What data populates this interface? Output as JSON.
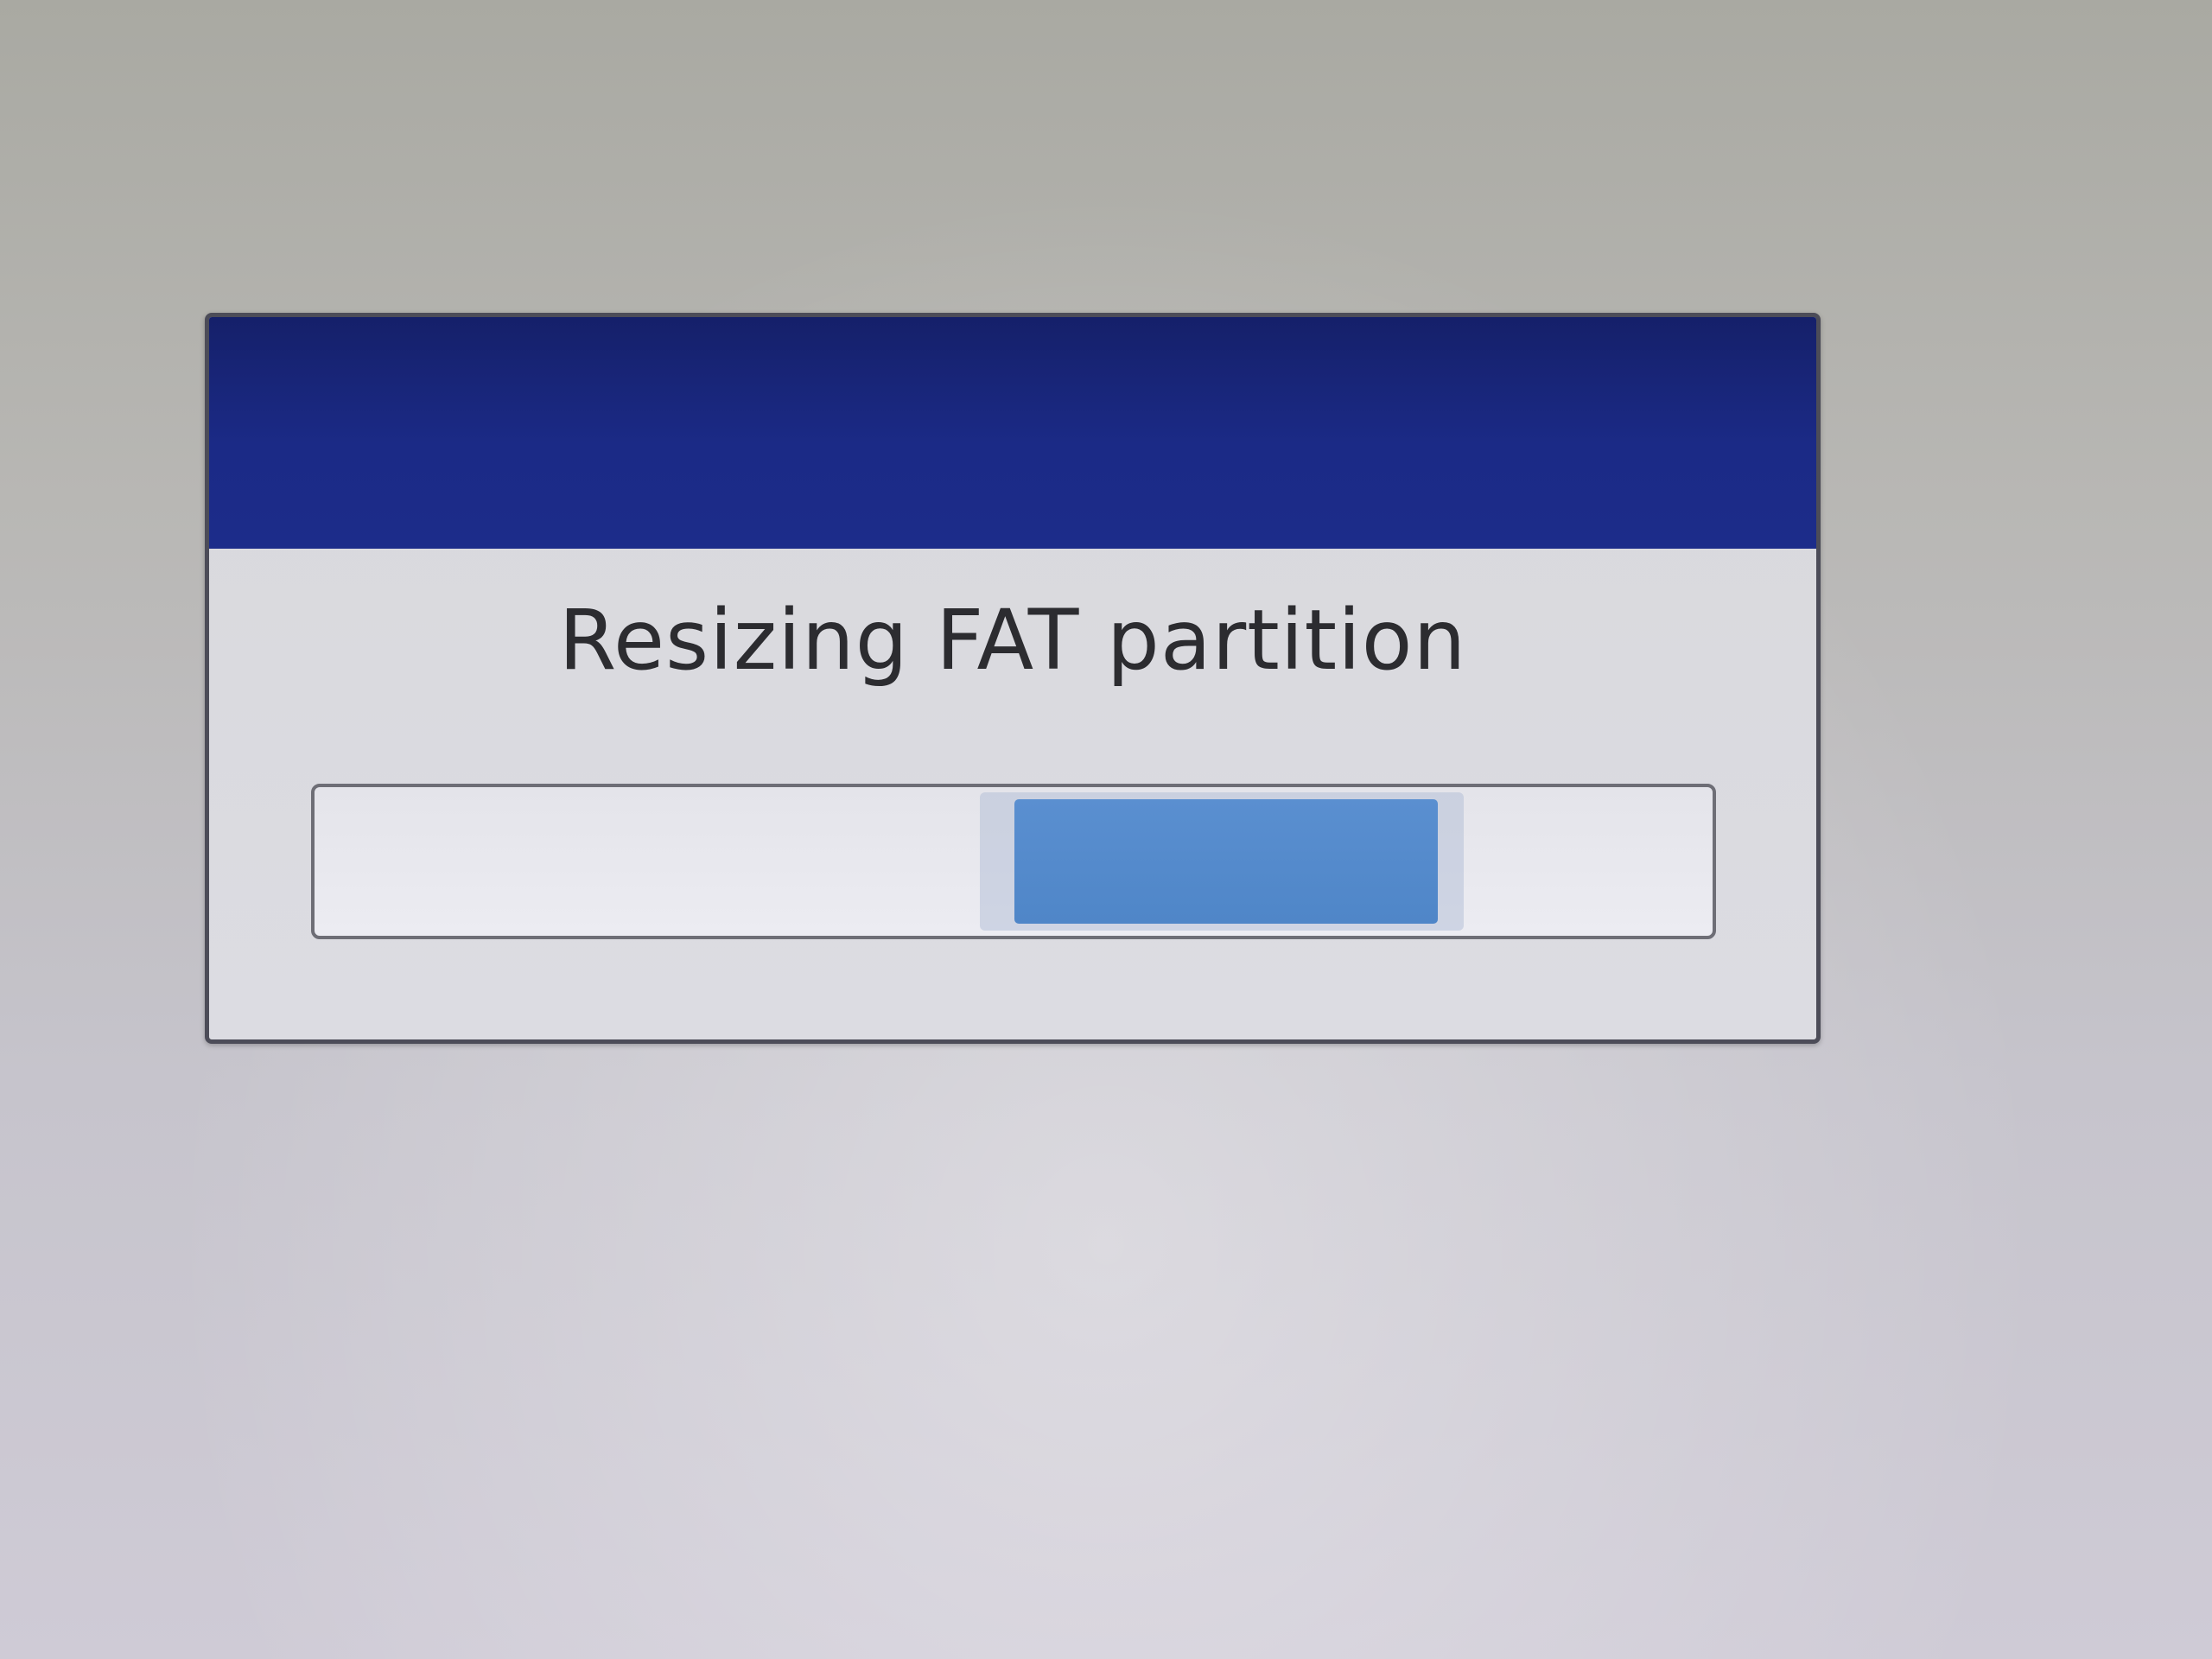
{
  "dialog": {
    "title": "",
    "message": "Resizing FAT partition",
    "progress": {
      "mode": "indeterminate",
      "color": "#5289cb"
    }
  },
  "colors": {
    "titlebar": "#1b2a86",
    "dialog_body": "#dadadf",
    "background": "#bdbcbf"
  }
}
